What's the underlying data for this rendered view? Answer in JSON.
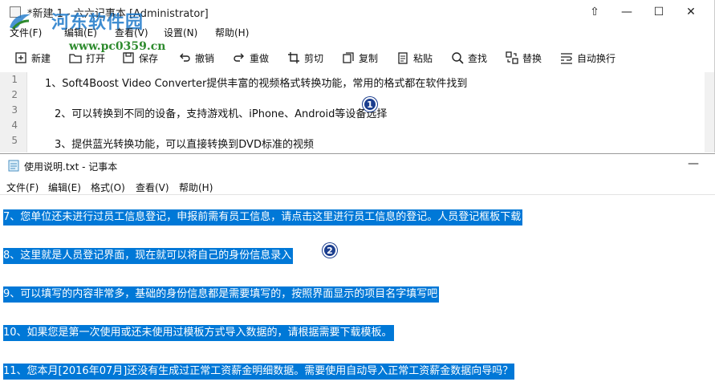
{
  "notepad1": {
    "title": "*新建 1 - 六六记事本 [Administrator]",
    "watermark_name": "河东软件园",
    "watermark_url": "www.pc0359.cn",
    "menu": [
      "文件(F)",
      "编辑(E)",
      "查看(V)",
      "设置(N)",
      "帮助(H)"
    ],
    "toolbar": [
      "新建",
      "打开",
      "保存",
      "撤销",
      "重做",
      "剪切",
      "复制",
      "粘贴",
      "查找",
      "替换",
      "自动换行"
    ],
    "line_numbers": [
      "1",
      "2",
      "3",
      "4",
      "5"
    ],
    "lines": [
      "1、Soft4Boost Video Converter提供丰富的视频格式转换功能，常用的格式都在软件找到",
      "2、可以转换到不同的设备，支持游戏机、iPhone、Android等设备选择",
      "3、提供蓝光转换功能，可以直接转换到DVD标准的视频"
    ],
    "badge": "1",
    "controls": {
      "restore": "⇧",
      "minimize": "—",
      "maximize": "☐",
      "close": "✕"
    }
  },
  "notepad2": {
    "title": "使用说明.txt - 记事本",
    "menu": [
      "文件(F)",
      "编辑(E)",
      "格式(O)",
      "查看(V)",
      "帮助(H)"
    ],
    "minimize": "—",
    "lines": [
      "    7、您单位还未进行过员工信息登记，申报前需有员工信息，请点击这里进行员工信息的登记。人员登记框板下载",
      "    8、这里就是人员登记界面，现在就可以将自己的身份信息录入",
      "    9、可以填写的内容非常多，基础的身份信息都是需要填写的，按照界面显示的项目名字填写吧",
      "    10、如果您是第一次使用或还未使用过模板方式导入数据的，请根据需要下载模板。",
      "    11、您本月[2016年07月]还没有生成过正常工资薪金明细数据。需要使用自动导入正常工资薪金数据向导吗？"
    ],
    "badge": "2"
  },
  "colors": {
    "selection": "#0078d7",
    "badge": "#1b3e8f",
    "watermark": "#1d78c9",
    "url": "#2e8b2e"
  }
}
